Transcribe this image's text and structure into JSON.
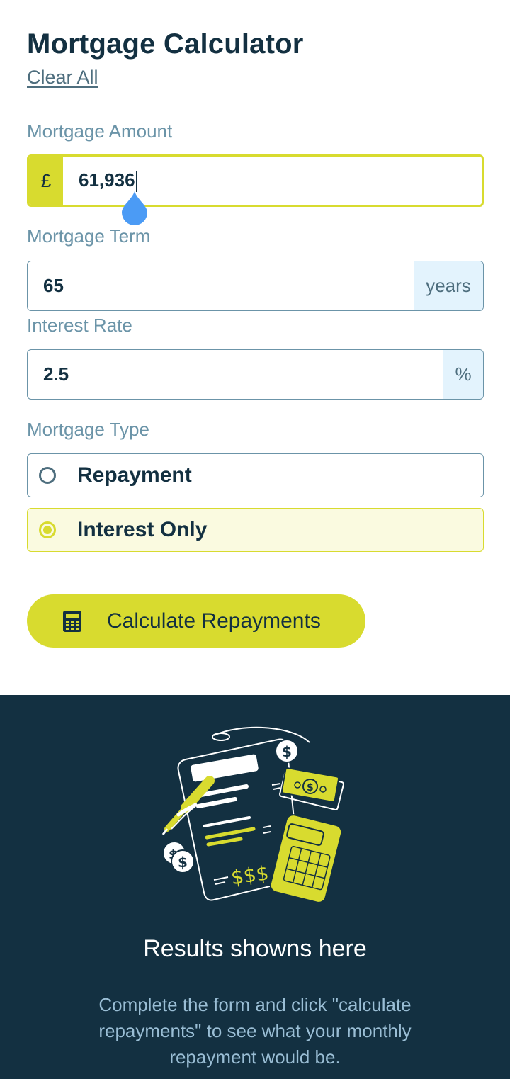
{
  "header": {
    "title": "Mortgage Calculator",
    "clear_label": "Clear All"
  },
  "amount": {
    "label": "Mortgage Amount",
    "prefix": "£",
    "value": "61,936"
  },
  "term": {
    "label": "Mortgage Term",
    "value": "65",
    "suffix": "years"
  },
  "rate": {
    "label": "Interest Rate",
    "value": "2.5",
    "suffix": "%"
  },
  "type": {
    "label": "Mortgage Type",
    "options": [
      {
        "label": "Repayment",
        "selected": false
      },
      {
        "label": "Interest Only",
        "selected": true
      }
    ]
  },
  "submit": {
    "label": "Calculate Repayments",
    "icon": "calculator-icon"
  },
  "results": {
    "title": "Results showns here",
    "description": "Complete the form and click \"calculate repayments\" to see what your monthly repayment would be."
  },
  "colors": {
    "accent": "#d8db2f",
    "dark": "#133041",
    "slate": "#6b94a8",
    "light_blue": "#e3f3fd",
    "drop": "#4b9bf5"
  }
}
